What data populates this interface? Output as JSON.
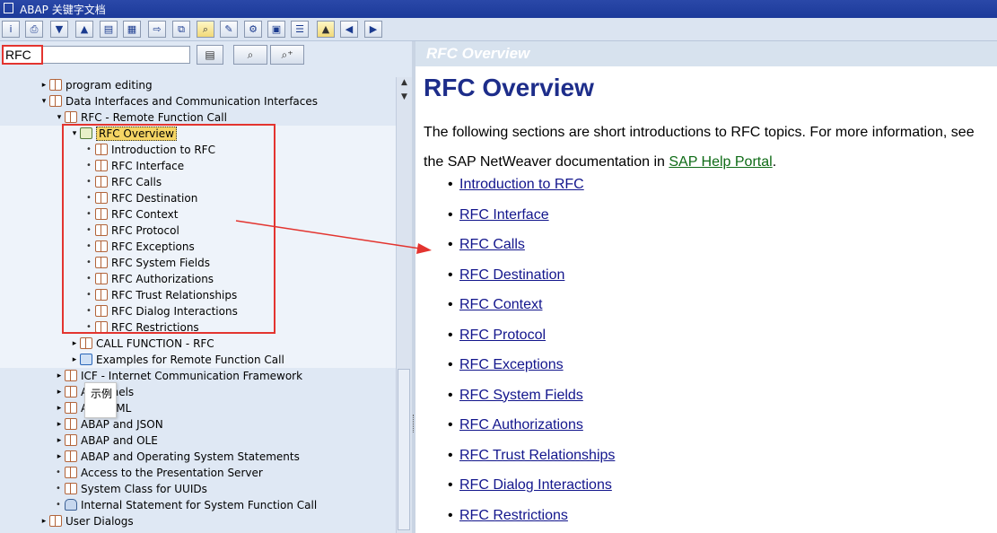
{
  "window": {
    "title": "ABAP 关键字文档"
  },
  "toolbar": {
    "buttons": [
      "info",
      "print",
      "expand-down",
      "expand-up",
      "print-preview",
      "page-setup",
      "export",
      "copy",
      "find-yellow",
      "edit",
      "settings",
      "help",
      "list",
      "hierarchy",
      "up",
      "back",
      "forward"
    ]
  },
  "search": {
    "value": "RFC"
  },
  "tree": {
    "items": [
      {
        "label": "program editing",
        "expander": "▸",
        "icon": "book-icon"
      },
      {
        "label": "Data Interfaces and Communication Interfaces",
        "expander": "▾",
        "icon": "book-icon"
      },
      {
        "label": "RFC - Remote Function Call",
        "expander": "▾",
        "icon": "book-icon"
      },
      {
        "label": "RFC Overview",
        "expander": "▾",
        "icon": "image-icon"
      },
      {
        "label": "Introduction to RFC",
        "expander": "•",
        "icon": "book-icon"
      },
      {
        "label": "RFC Interface",
        "expander": "•",
        "icon": "book-icon"
      },
      {
        "label": "RFC Calls",
        "expander": "•",
        "icon": "book-icon"
      },
      {
        "label": "RFC Destination",
        "expander": "•",
        "icon": "book-icon"
      },
      {
        "label": "RFC Context",
        "expander": "•",
        "icon": "book-icon"
      },
      {
        "label": "RFC Protocol",
        "expander": "•",
        "icon": "book-icon"
      },
      {
        "label": "RFC Exceptions",
        "expander": "•",
        "icon": "book-icon"
      },
      {
        "label": "RFC System Fields",
        "expander": "•",
        "icon": "book-icon"
      },
      {
        "label": "RFC Authorizations",
        "expander": "•",
        "icon": "book-icon"
      },
      {
        "label": "RFC Trust Relationships",
        "expander": "•",
        "icon": "book-icon"
      },
      {
        "label": "RFC Dialog Interactions",
        "expander": "•",
        "icon": "book-icon"
      },
      {
        "label": "RFC Restrictions",
        "expander": "•",
        "icon": "book-icon"
      },
      {
        "label": "CALL FUNCTION - RFC",
        "expander": "▸",
        "icon": "book-icon"
      },
      {
        "label": "Examples for Remote Function Call",
        "expander": "▸",
        "icon": "gear-icon"
      },
      {
        "label": "ICF - Internet Communication Framework",
        "expander": "▸",
        "icon": "book-icon"
      },
      {
        "label": "A   hannels",
        "expander": "▸",
        "icon": "book-icon"
      },
      {
        "label": "A   nd XML",
        "expander": "▸",
        "icon": "book-icon"
      },
      {
        "label": "ABAP and JSON",
        "expander": "▸",
        "icon": "book-icon"
      },
      {
        "label": "ABAP and OLE",
        "expander": "▸",
        "icon": "book-icon"
      },
      {
        "label": "ABAP and Operating System Statements",
        "expander": "▸",
        "icon": "book-icon"
      },
      {
        "label": "Access to the Presentation Server",
        "expander": "•",
        "icon": "book-icon"
      },
      {
        "label": "System Class for UUIDs",
        "expander": "•",
        "icon": "book-icon"
      },
      {
        "label": "Internal Statement for System Function Call",
        "expander": "•",
        "icon": "lock-icon"
      },
      {
        "label": "User Dialogs",
        "expander": "▸",
        "icon": "book-icon"
      }
    ]
  },
  "tooltip": {
    "text": "示例"
  },
  "doc": {
    "header": "RFC Overview",
    "title": "RFC Overview",
    "intro": "The following sections are short introductions to RFC topics. For more information, see the SAP NetWeaver documentation in",
    "link_text": "SAP Help Portal",
    "period": ".",
    "links": [
      "Introduction to RFC",
      "RFC Interface",
      "RFC Calls",
      "RFC Destination",
      "RFC Context",
      "RFC Protocol",
      "RFC Exceptions",
      "RFC System Fields",
      "RFC Authorizations",
      "RFC Trust Relationships",
      "RFC Dialog Interactions",
      "RFC Restrictions"
    ]
  },
  "colors": {
    "annotation_red": "#e3342f",
    "link_blue": "#12158c",
    "title_navy": "#1d2d8a",
    "selected_yellow": "#f5d564"
  }
}
